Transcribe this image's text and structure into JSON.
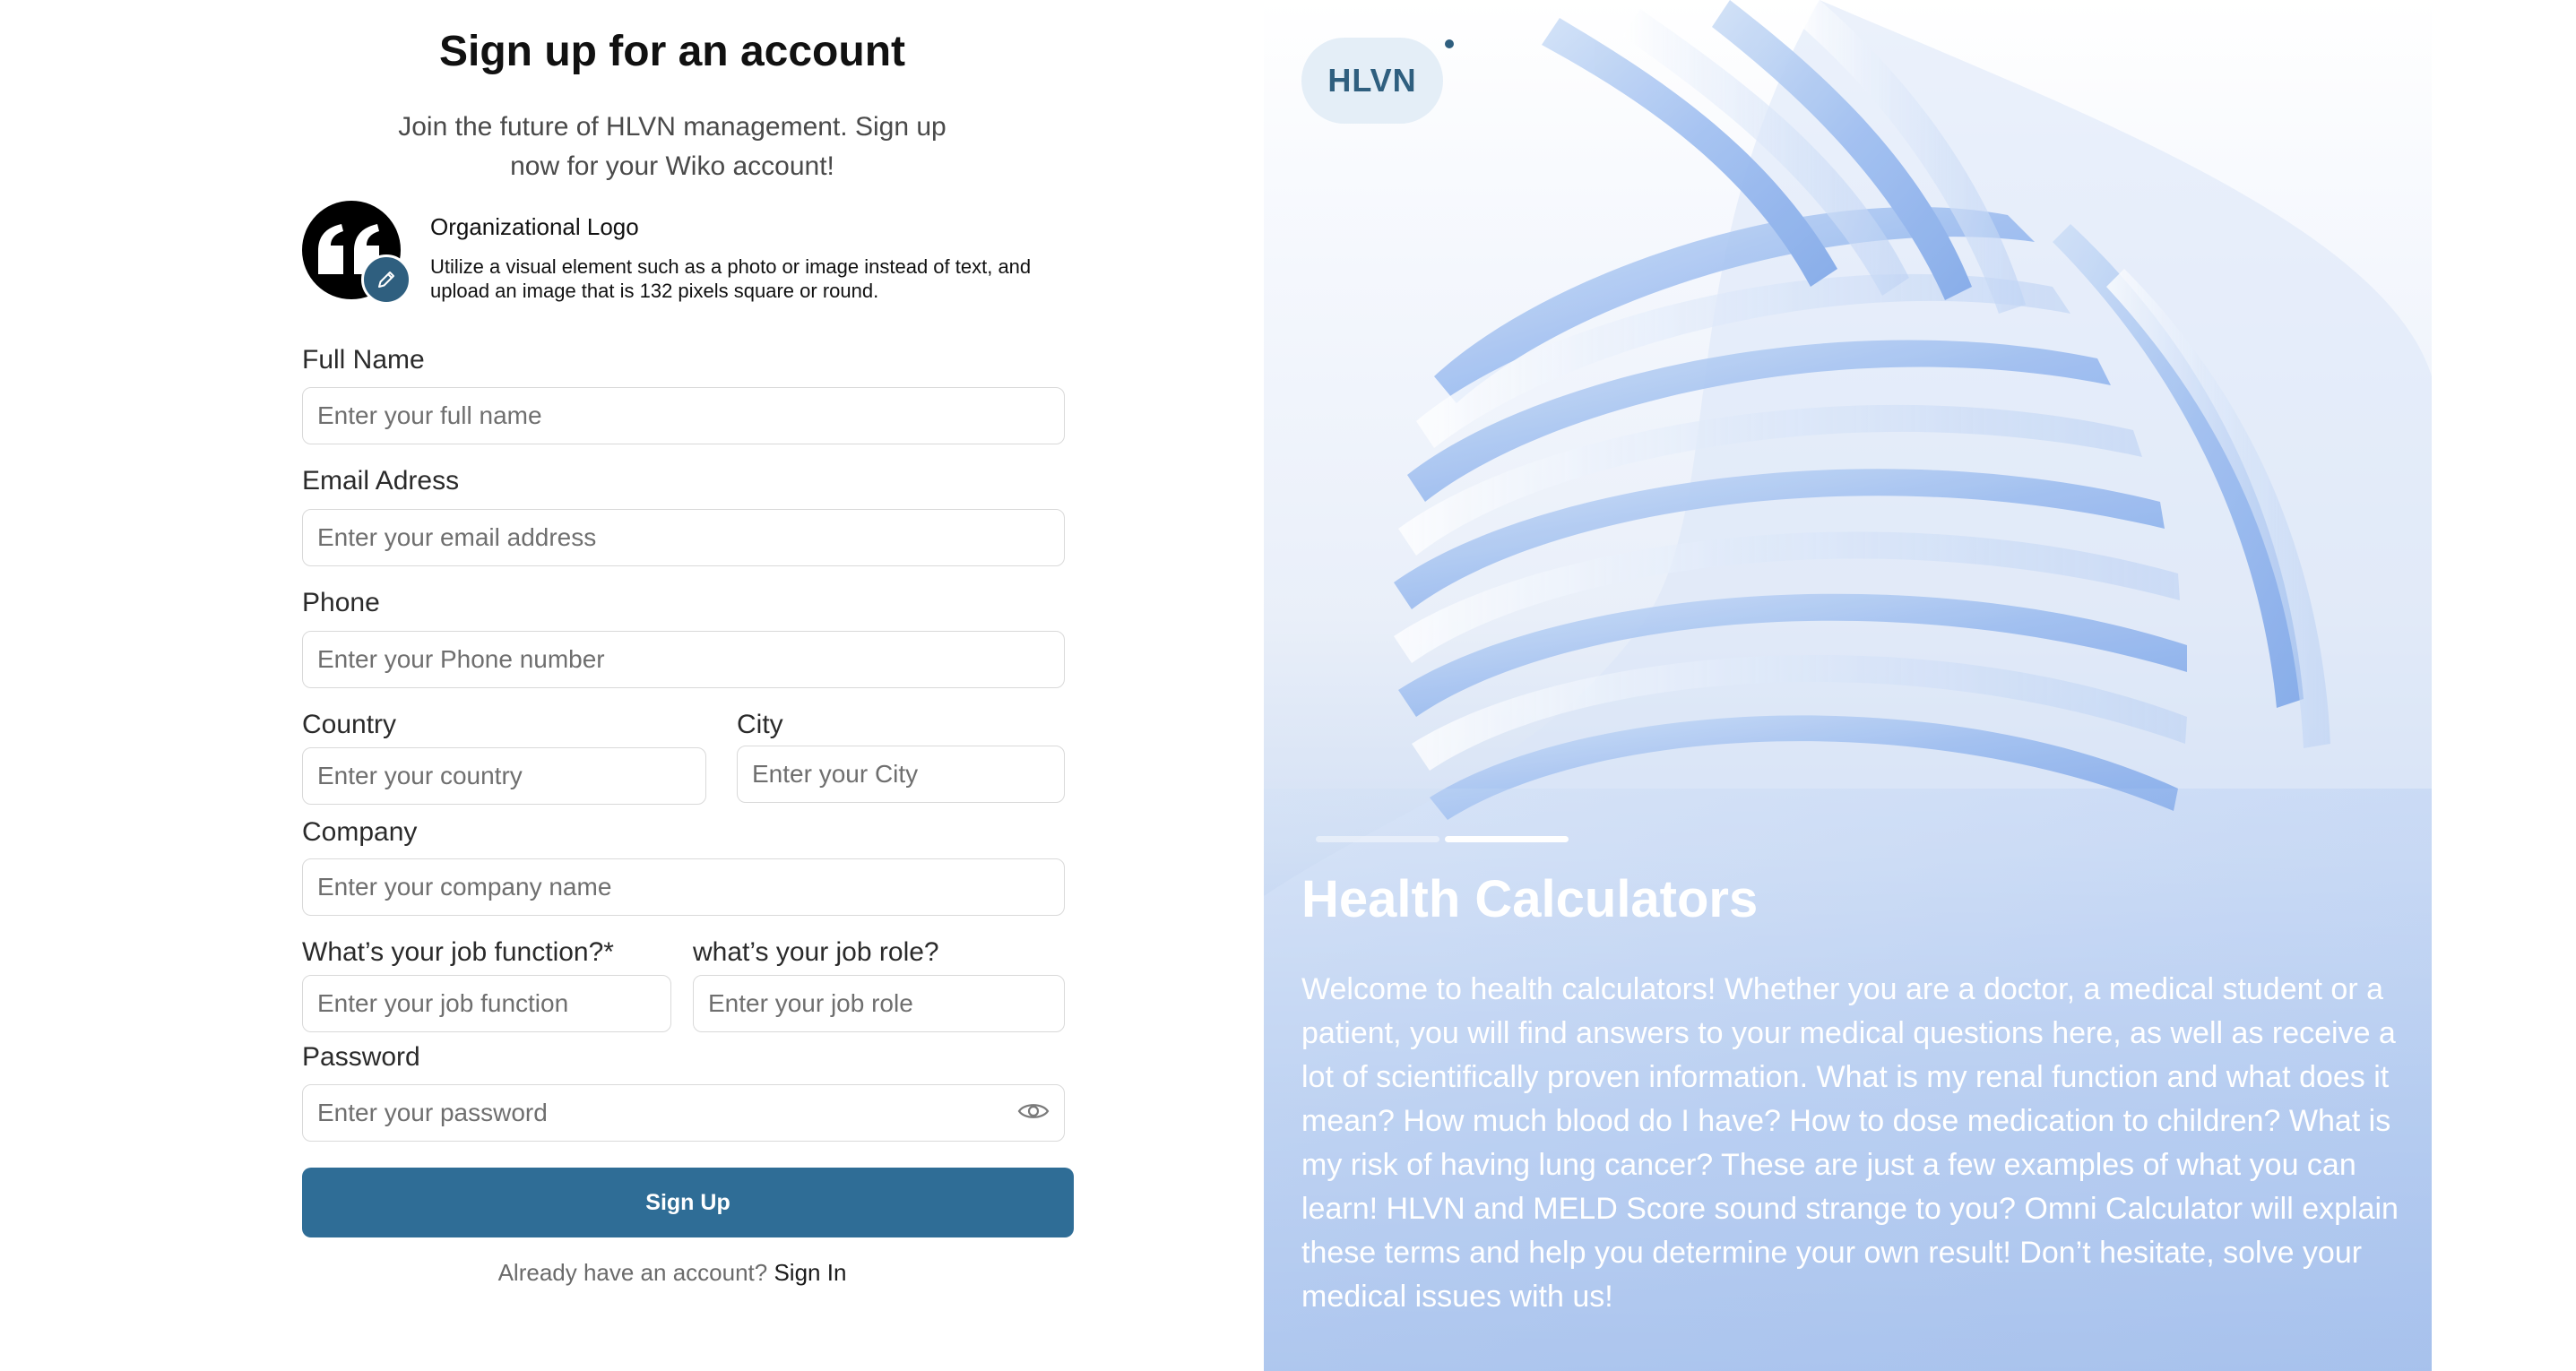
{
  "form": {
    "title": "Sign up for an account",
    "subtitle": "Join the future of HLVN management. Sign up now for your Wiko account!",
    "logo": {
      "title": "Organizational Logo",
      "description": "Utilize a visual element such as a photo or image instead of text, and upload an image that is 132 pixels square or round."
    },
    "fields": {
      "full_name": {
        "label": "Full Name",
        "placeholder": "Enter your full name"
      },
      "email": {
        "label": "Email Adress",
        "placeholder": "Enter your email address"
      },
      "phone": {
        "label": "Phone",
        "placeholder": "Enter your Phone number"
      },
      "country": {
        "label": "Country",
        "placeholder": "Enter your country"
      },
      "city": {
        "label": "City",
        "placeholder": "Enter your City"
      },
      "company": {
        "label": "Company",
        "placeholder": "Enter your company name"
      },
      "job_function": {
        "label": "What’s your job function?*",
        "placeholder": "Enter your job function"
      },
      "job_role": {
        "label": "what’s your job role?",
        "placeholder": "Enter your job role"
      },
      "password": {
        "label": "Password",
        "placeholder": "Enter your password"
      }
    },
    "submit_label": "Sign Up",
    "signin_prompt": "Already have an account?",
    "signin_link": "Sign In"
  },
  "hero": {
    "brand": "HLVN",
    "title": "Health Calculators",
    "body": "Welcome to health calculators! Whether you are a doctor, a medical student or a patient, you will find answers to your medical questions here, as well as receive a lot of scientifically proven information. What is my renal function and what does it mean? How much blood do I have? How to dose medication to children? What is my risk of having lung cancer? These are just a few examples of what you can learn! HLVN and MELD Score sound strange to you? Omni Calculator will explain these terms and help you determine your own result! Don’t hesitate, solve your medical issues with us!",
    "slides_total": 2,
    "active_slide": 2
  },
  "colors": {
    "primary": "#2f6d96",
    "brand": "#2f5f7f",
    "border": "#d9d9d9",
    "hero_blue": "#86a9e2"
  }
}
